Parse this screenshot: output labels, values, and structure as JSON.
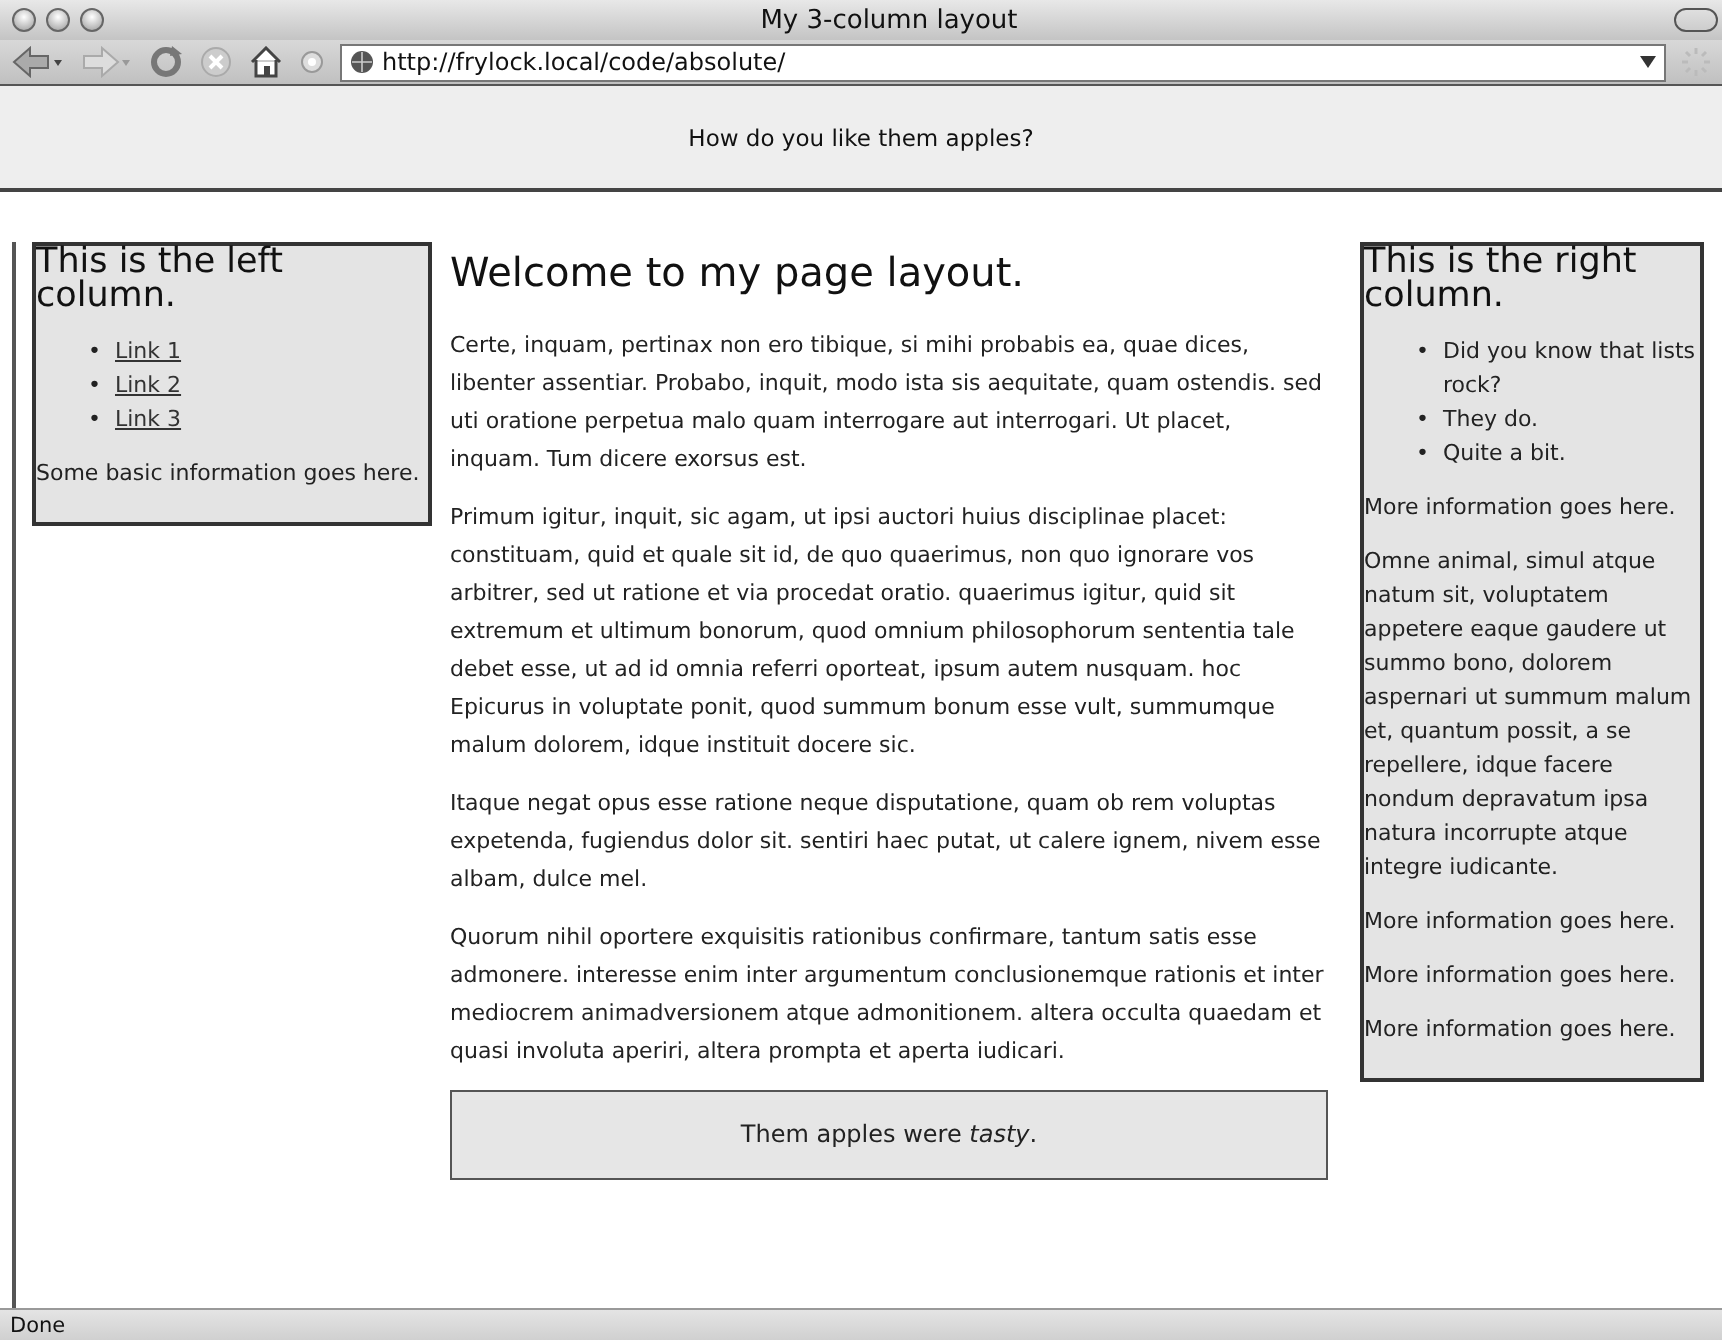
{
  "window": {
    "title": "My 3-column layout"
  },
  "toolbar": {
    "address": "http://frylock.local/code/absolute/"
  },
  "header": {
    "text": "How do you like them apples?"
  },
  "left_column": {
    "bullet": "•",
    "heading": "This is the left column.",
    "links": [
      "Link 1",
      "Link 2",
      "Link 3"
    ],
    "text": "Some basic information goes here."
  },
  "main": {
    "heading": "Welcome to my page layout.",
    "paragraphs": [
      "Certe, inquam, pertinax non ero tibique, si mihi probabis ea, quae dices, libenter assentiar. Probabo, inquit, modo ista sis aequitate, quam ostendis. sed uti oratione perpetua malo quam interrogare aut interrogari. Ut placet, inquam. Tum dicere exorsus est.",
      "Primum igitur, inquit, sic agam, ut ipsi auctori huius disciplinae placet: constituam, quid et quale sit id, de quo quaerimus, non quo ignorare vos arbitrer, sed ut ratione et via procedat oratio. quaerimus igitur, quid sit extremum et ultimum bonorum, quod omnium philosophorum sententia tale debet esse, ut ad id omnia referri oporteat, ipsum autem nusquam. hoc Epicurus in voluptate ponit, quod summum bonum esse vult, summumque malum dolorem, idque instituit docere sic.",
      "Itaque negat opus esse ratione neque disputatione, quam ob rem voluptas expetenda, fugiendus dolor sit. sentiri haec putat, ut calere ignem, nivem esse albam, dulce mel.",
      "Quorum nihil oportere exquisitis rationibus confirmare, tantum satis esse admonere. interesse enim inter argumentum conclusionemque rationis et inter mediocrem animadversionem atque admonitionem. altera occulta quaedam et quasi involuta aperiri, altera prompta et aperta iudicari."
    ],
    "footer": "Them apples were *tasty*."
  },
  "right_column": {
    "bullet": "•",
    "heading": "This is the right column.",
    "list": [
      "Did you know that lists rock?",
      "They do.",
      "Quite a bit."
    ],
    "paragraphs": [
      "More information goes here.",
      "Omne animal, simul atque natum sit, voluptatem appetere eaque gaudere ut summo bono, dolorem aspernari ut summum malum et, quantum possit, a se repellere, idque facere nondum depravatum ipsa natura incorrupte atque integre iudicante.",
      "More information goes here.",
      "More information goes here.",
      "More information goes here."
    ]
  },
  "status_bar": {
    "text": "Done"
  }
}
